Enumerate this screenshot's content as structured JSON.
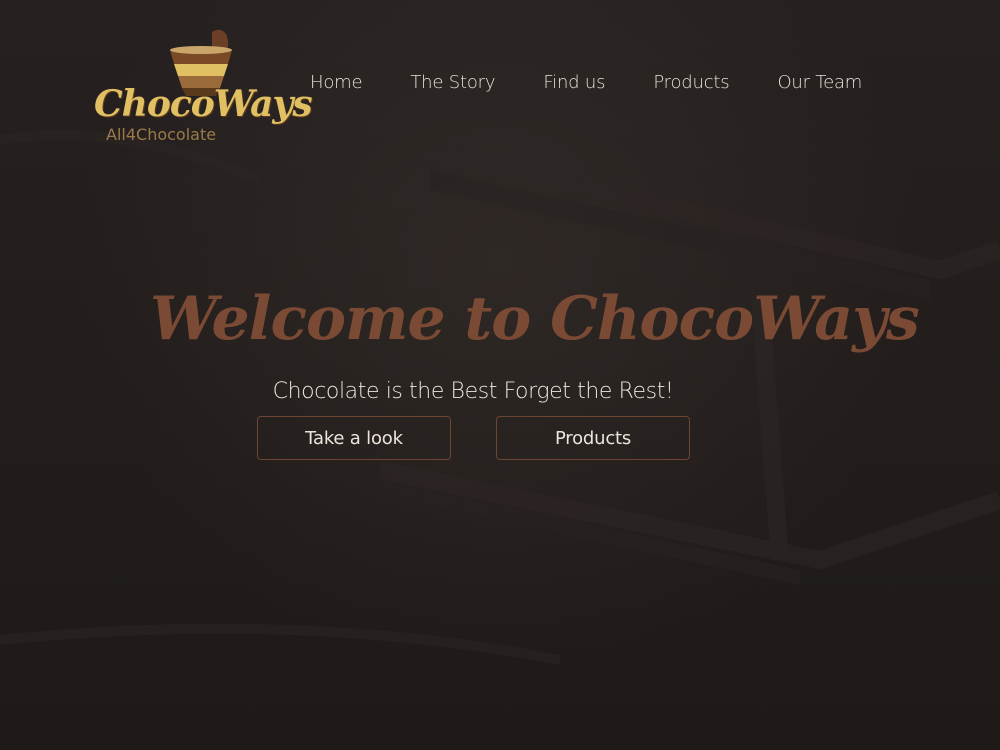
{
  "brand": {
    "name": "ChocoWays",
    "tagline": "All4Chocolate",
    "accent_color": "#e0c062"
  },
  "nav": {
    "items": [
      {
        "label": "Home"
      },
      {
        "label": "The Story"
      },
      {
        "label": "Find us"
      },
      {
        "label": "Products"
      },
      {
        "label": "Our Team"
      }
    ]
  },
  "hero": {
    "title": "Welcome to ChocoWays",
    "subtitle": "Chocolate is the Best Forget the Rest!",
    "title_color": "#7a4a34",
    "buttons": {
      "take_a_look": "Take a look",
      "products": "Products"
    }
  },
  "icons": {
    "logo": "chocolate-cup-icon"
  }
}
